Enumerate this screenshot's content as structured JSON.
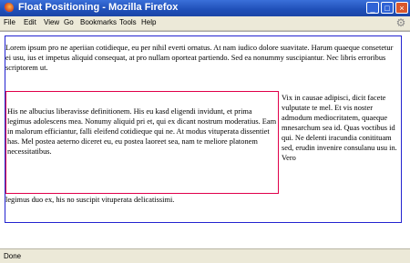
{
  "window": {
    "title": "Float Positioning - Mozilla Firefox",
    "min_glyph": "_",
    "max_glyph": "□",
    "close_glyph": "×"
  },
  "menu": [
    "File",
    "Edit",
    "View",
    "Go",
    "Bookmarks",
    "Tools",
    "Help"
  ],
  "content": {
    "paragraph1": "Lorem ipsum pro ne aperiian cotidieque, eu per nihil everti ornatus. At nam iudico dolore suavitate. Harum quaeque consetetur ei usu, ius et impetus aliquid consequat, at pro nullam oporteat partiendo. Sed ea nonummy suscipiantur. Nec libris erroribus scriptorem ut.",
    "float_text": "His ne albucius liberavisse definitionem. His eu kasd eligendi invidunt, et prima legimus adolescens mea. Nonumy aliquid pri et, qui ex dicant nostrum moderatius. Eam in malorum efficiantur, falli eleifend cotidieque qui ne. At modus vituperata dissentiet has. Mel postea aeterno diceret eu, eu postea laoreet sea, nam te meliore platonem necessitatibus.",
    "right_text": "Vix in causae adipisci, dicit facete vulputate te mel. Et vis noster admodum mediocritatem, quaeque mnesarchum sea id. Quas voctibus id qui. Ne delenti iracundia conitituam sed, erudin invenire consulanu usu in. Vero",
    "last_line": "legimus duo ex, his no suscipit vituperata delicatissimi."
  },
  "status": {
    "text": "Done"
  },
  "colors": {
    "titlebar": "#2458c4",
    "page_border": "#2323d0",
    "float_border": "#e0004a"
  },
  "icons": {
    "app": "firefox-icon",
    "throbber": "gear-icon"
  }
}
